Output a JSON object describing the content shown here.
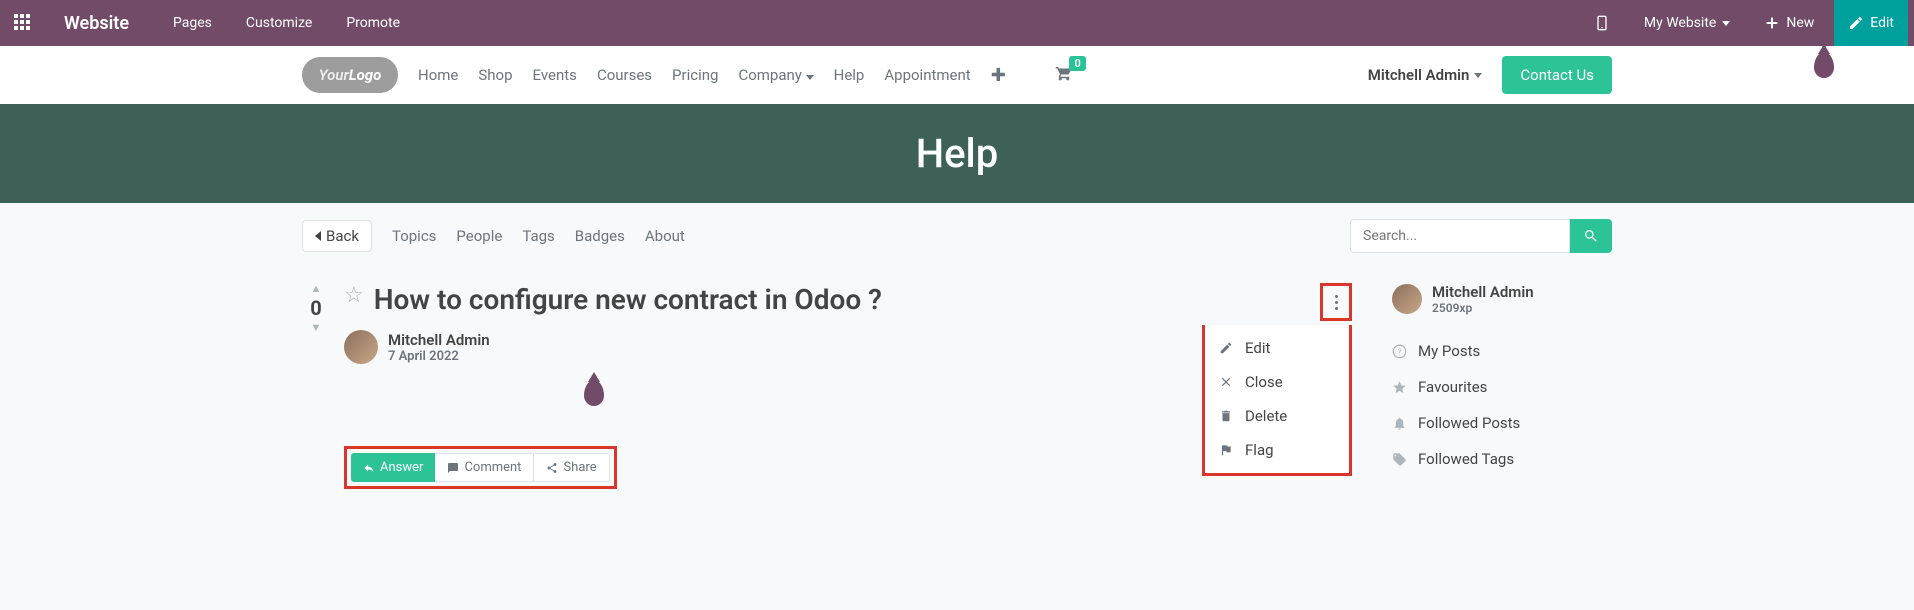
{
  "topbar": {
    "brand": "Website",
    "links": {
      "pages": "Pages",
      "customize": "Customize",
      "promote": "Promote"
    },
    "mysite": "My Website",
    "new": "New",
    "edit": "Edit"
  },
  "nav": {
    "home": "Home",
    "shop": "Shop",
    "events": "Events",
    "courses": "Courses",
    "pricing": "Pricing",
    "company": "Company",
    "help": "Help",
    "appointment": "Appointment",
    "cart_count": "0",
    "user": "Mitchell Admin",
    "contact": "Contact Us"
  },
  "hero": {
    "title": "Help"
  },
  "forum_nav": {
    "back": "Back",
    "topics": "Topics",
    "people": "People",
    "tags": "Tags",
    "badges": "Badges",
    "about": "About",
    "search_placeholder": "Search..."
  },
  "question": {
    "votes": "0",
    "title": "How to configure new contract in Odoo ?",
    "author": "Mitchell Admin",
    "date": "7 April 2022",
    "actions": {
      "answer": "Answer",
      "comment": "Comment",
      "share": "Share"
    }
  },
  "dropdown": {
    "edit": "Edit",
    "close": "Close",
    "delete": "Delete",
    "flag": "Flag"
  },
  "sidebar": {
    "user": "Mitchell Admin",
    "xp": "2509xp",
    "myposts": "My Posts",
    "favourites": "Favourites",
    "followed_posts": "Followed Posts",
    "followed_tags": "Followed Tags"
  }
}
